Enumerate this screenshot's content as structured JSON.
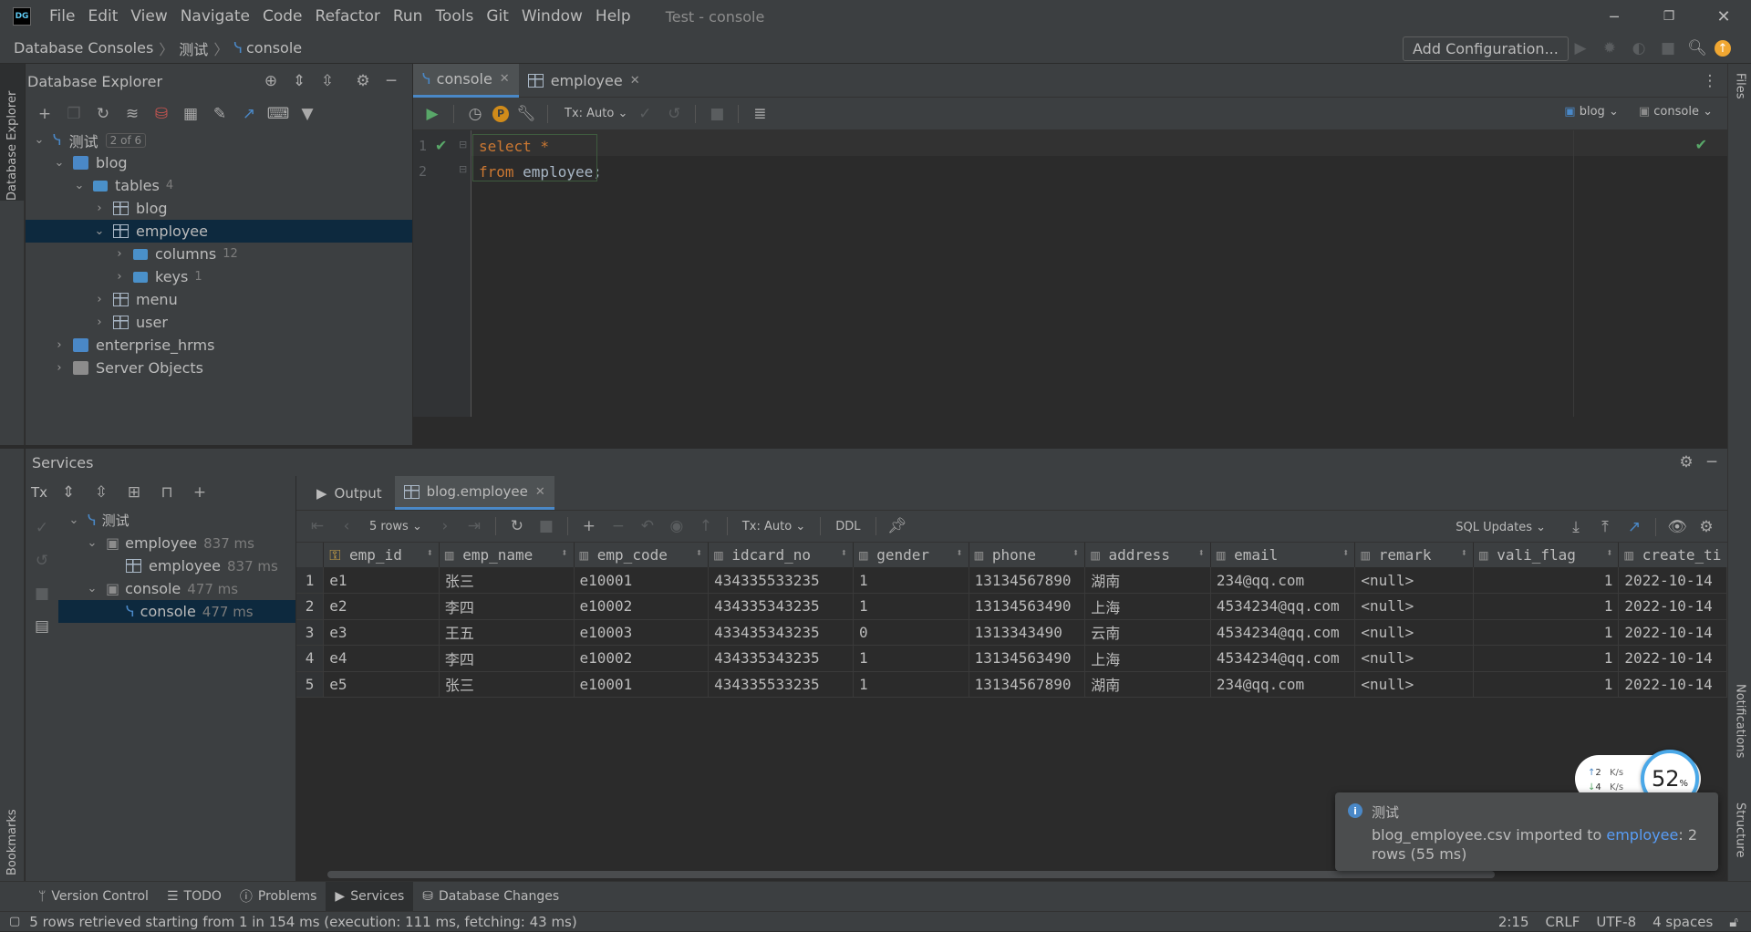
{
  "window": {
    "title": "Test - console",
    "app_icon": "DG"
  },
  "menu": [
    "File",
    "Edit",
    "View",
    "Navigate",
    "Code",
    "Refactor",
    "Run",
    "Tools",
    "Git",
    "Window",
    "Help"
  ],
  "breadcrumb": [
    "Database Consoles",
    "测试",
    "console"
  ],
  "toolbar": {
    "add_config": "Add Configuration..."
  },
  "db_explorer": {
    "title": "Database Explorer",
    "tree": {
      "root": {
        "label": "测试",
        "badge": "2 of 6"
      },
      "blog": {
        "label": "blog"
      },
      "tables": {
        "label": "tables",
        "count": "4"
      },
      "t_blog": {
        "label": "blog"
      },
      "t_employee": {
        "label": "employee"
      },
      "columns": {
        "label": "columns",
        "count": "12"
      },
      "keys": {
        "label": "keys",
        "count": "1"
      },
      "t_menu": {
        "label": "menu"
      },
      "t_user": {
        "label": "user"
      },
      "enterprise": {
        "label": "enterprise_hrms"
      },
      "server_objects": {
        "label": "Server Objects"
      }
    }
  },
  "editor": {
    "tabs": [
      {
        "label": "console"
      },
      {
        "label": "employee"
      }
    ],
    "tx": "Tx: Auto",
    "schema": "blog",
    "session": "console",
    "lines": [
      {
        "num": "1",
        "kw": "select",
        "rest": " *"
      },
      {
        "num": "2",
        "kw": "from",
        "rest": " employee;"
      }
    ]
  },
  "services": {
    "title": "Services",
    "tree": {
      "root": {
        "label": "测试"
      },
      "employee_group": {
        "label": "employee",
        "time": "837 ms"
      },
      "employee": {
        "label": "employee",
        "time": "837 ms"
      },
      "console_group": {
        "label": "console",
        "time": "477 ms"
      },
      "console": {
        "label": "console",
        "time": "477 ms"
      }
    },
    "tabs": [
      {
        "label": "Output"
      },
      {
        "label": "blog.employee"
      }
    ],
    "rows_select": "5 rows",
    "tx": "Tx: Auto",
    "ddl": "DDL",
    "sql_updates": "SQL Updates"
  },
  "grid": {
    "columns": [
      "emp_id",
      "emp_name",
      "emp_code",
      "idcard_no",
      "gender",
      "phone",
      "address",
      "email",
      "remark",
      "vali_flag",
      "create_ti"
    ],
    "rows": [
      [
        "1",
        "e1",
        "张三",
        "e10001",
        "434335533235",
        "1",
        "13134567890",
        "湖南",
        "234@qq.com",
        "<null>",
        "1",
        "2022-10-14"
      ],
      [
        "2",
        "e2",
        "李四",
        "e10002",
        "434335343235",
        "1",
        "13134563490",
        "上海",
        "4534234@qq.com",
        "<null>",
        "1",
        "2022-10-14"
      ],
      [
        "3",
        "e3",
        "王五",
        "e10003",
        "433435343235",
        "0",
        "1313343490",
        "云南",
        "4534234@qq.com",
        "<null>",
        "1",
        "2022-10-14"
      ],
      [
        "4",
        "e4",
        "李四",
        "e10002",
        "434335343235",
        "1",
        "13134563490",
        "上海",
        "4534234@qq.com",
        "<null>",
        "1",
        "2022-10-14"
      ],
      [
        "5",
        "e5",
        "张三",
        "e10001",
        "434335533235",
        "1",
        "13134567890",
        "湖南",
        "234@qq.com",
        "<null>",
        "1",
        "2022-10-14"
      ]
    ]
  },
  "notification": {
    "title": "测试",
    "message_prefix": "blog_employee.csv imported to ",
    "link": "employee",
    "message_suffix": ": 2",
    "message_line2": "rows (55 ms)"
  },
  "net_widget": {
    "up": "2",
    "down": "4",
    "unit": "K/s",
    "percent": "52",
    "pct_sign": "%"
  },
  "bottom_tabs": [
    "Version Control",
    "TODO",
    "Problems",
    "Services",
    "Database Changes"
  ],
  "left_stripe": {
    "top": "Database Explorer",
    "bottom": "Bookmarks"
  },
  "right_stripe": {
    "top": "Files",
    "mid": "Notifications",
    "bottom": "Structure"
  },
  "status": {
    "message": "5 rows retrieved starting from 1 in 154 ms (execution: 111 ms, fetching: 43 ms)",
    "position": "2:15",
    "line_sep": "CRLF",
    "encoding": "UTF-8",
    "indent": "4 spaces"
  },
  "colors": {
    "accent": "#4a88c7",
    "selection": "#0d293e",
    "keyword": "#cc7832",
    "link": "#589df6",
    "run": "#59a869"
  }
}
